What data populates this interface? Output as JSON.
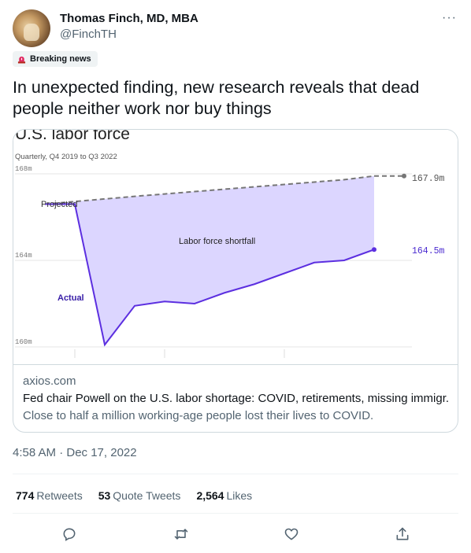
{
  "author": {
    "name": "Thomas Finch, MD, MBA",
    "handle": "@FinchTH"
  },
  "badge": {
    "label": "Breaking news",
    "icon": "siren-icon"
  },
  "tweet_text": "In unexpected finding, new research reveals that dead people neither work nor buy things",
  "card": {
    "chart_title": "U.S. labor force",
    "chart_subtitle": "Quarterly, Q4 2019 to Q3 2022",
    "domain": "axios.com",
    "title": "Fed chair Powell on the U.S. labor shortage: COVID, retirements, missing immigr...",
    "description": "Close to half a million working-age people lost their lives to COVID."
  },
  "chart_data": {
    "type": "line",
    "title": "U.S. labor force",
    "subtitle": "Quarterly, Q4 2019 to Q3 2022",
    "ylim": [
      160,
      168.6
    ],
    "yticks": [
      "168m",
      "164m",
      "160m"
    ],
    "ytick_values": [
      168,
      164,
      160
    ],
    "x_count": 12,
    "series": [
      {
        "name": "Projected",
        "color": "#767676",
        "dashed": true,
        "values": [
          166.6,
          166.72,
          166.84,
          166.96,
          167.07,
          167.18,
          167.29,
          167.4,
          167.51,
          167.62,
          167.73,
          167.9
        ]
      },
      {
        "name": "Actual",
        "color": "#5c2fe0",
        "dashed": false,
        "values": [
          166.6,
          166.6,
          160.1,
          161.9,
          162.1,
          162.0,
          162.5,
          162.9,
          163.4,
          163.9,
          164.0,
          164.5
        ]
      }
    ],
    "shaded_label": "Labor force shortfall",
    "shade_color": "#dcd6ff",
    "end_labels": [
      "167.9m",
      "164.5m"
    ]
  },
  "timestamp": "4:58 AM · Dec 17, 2022",
  "stats": {
    "retweets_count": "774",
    "retweets_label": "Retweets",
    "quotes_count": "53",
    "quotes_label": "Quote Tweets",
    "likes_count": "2,564",
    "likes_label": "Likes"
  },
  "actions": [
    "reply-icon",
    "retweet-icon",
    "like-icon",
    "share-icon"
  ]
}
